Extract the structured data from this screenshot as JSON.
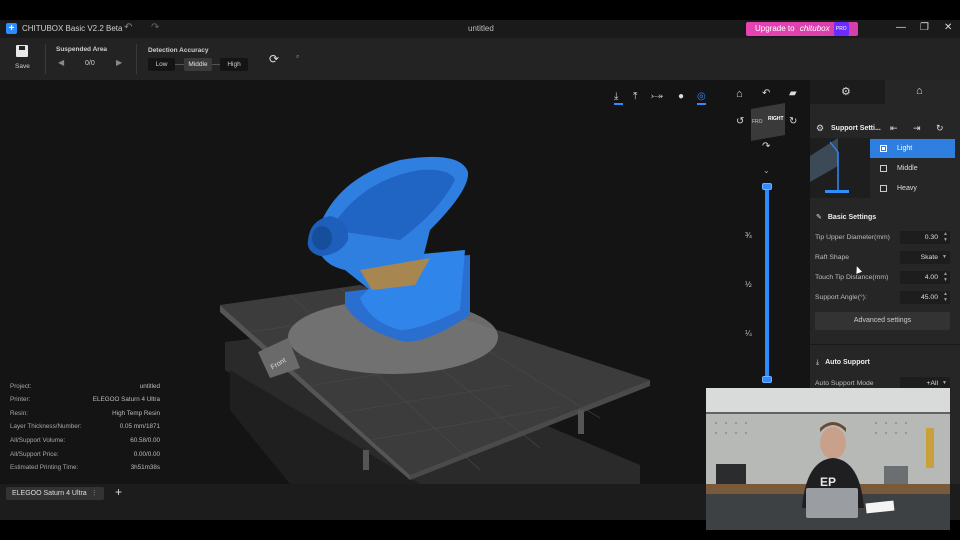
{
  "titlebar": {
    "app_title": "CHITUBOX Basic V2.2 Beta",
    "doc_title": "untitled",
    "upgrade_label": "Upgrade to",
    "upgrade_brand": "chitubox",
    "upgrade_badge": "PRO",
    "undo_icon": "↶",
    "redo_icon": "↷",
    "min_icon": "—",
    "max_icon": "❐",
    "close_icon": "✕"
  },
  "toolbar": {
    "save_label": "Save",
    "suspended_area_label": "Suspended Area",
    "suspended_count": "0/0",
    "detection_accuracy_label": "Detection Accuracy",
    "accuracy_options": [
      "Low",
      "Middle",
      "High"
    ],
    "accuracy_selected": "Middle"
  },
  "viewport": {
    "layer_fractions": [
      "¾",
      "½",
      "¼"
    ],
    "plate_label": "Front"
  },
  "project_info": [
    {
      "label": "Project:",
      "value": "untitled"
    },
    {
      "label": "Printer:",
      "value": "ELEGOO Saturn 4 Ultra"
    },
    {
      "label": "Resin:",
      "value": "High Temp Resin"
    },
    {
      "label": "Layer Thickness/Number:",
      "value": "0.05 mm/1871"
    },
    {
      "label": "All/Support Volume:",
      "value": "60.58/0.00"
    },
    {
      "label": "All/Support Price:",
      "value": "0.00/0.00"
    },
    {
      "label": "Estimated Printing Time:",
      "value": "3h51m38s"
    }
  ],
  "bottombar": {
    "printer_tab": "ELEGOO Saturn 4 Ultra",
    "add_tab": "+"
  },
  "panel": {
    "support_settings_title": "Support Setti...",
    "density_options": [
      "Light",
      "Middle",
      "Heavy"
    ],
    "density_selected": "Light",
    "basic_settings_title": "Basic Settings",
    "params": [
      {
        "label": "Tip Upper Diameter(mm)",
        "value": "0.30"
      },
      {
        "label": "Raft Shape",
        "value": "Skate"
      },
      {
        "label": "Touch Tip Distance(mm)",
        "value": "4.00"
      },
      {
        "label": "Support Angle(°):",
        "value": "45.00"
      }
    ],
    "advanced_settings_label": "Advanced settings",
    "auto_support_title": "Auto Support",
    "auto_support_mode_label": "Auto Support Mode",
    "auto_support_mode_value": "+All"
  },
  "colors": {
    "accent": "#2f7fe0",
    "model": "#2d7fe0",
    "upgrade": "#e843b2"
  }
}
